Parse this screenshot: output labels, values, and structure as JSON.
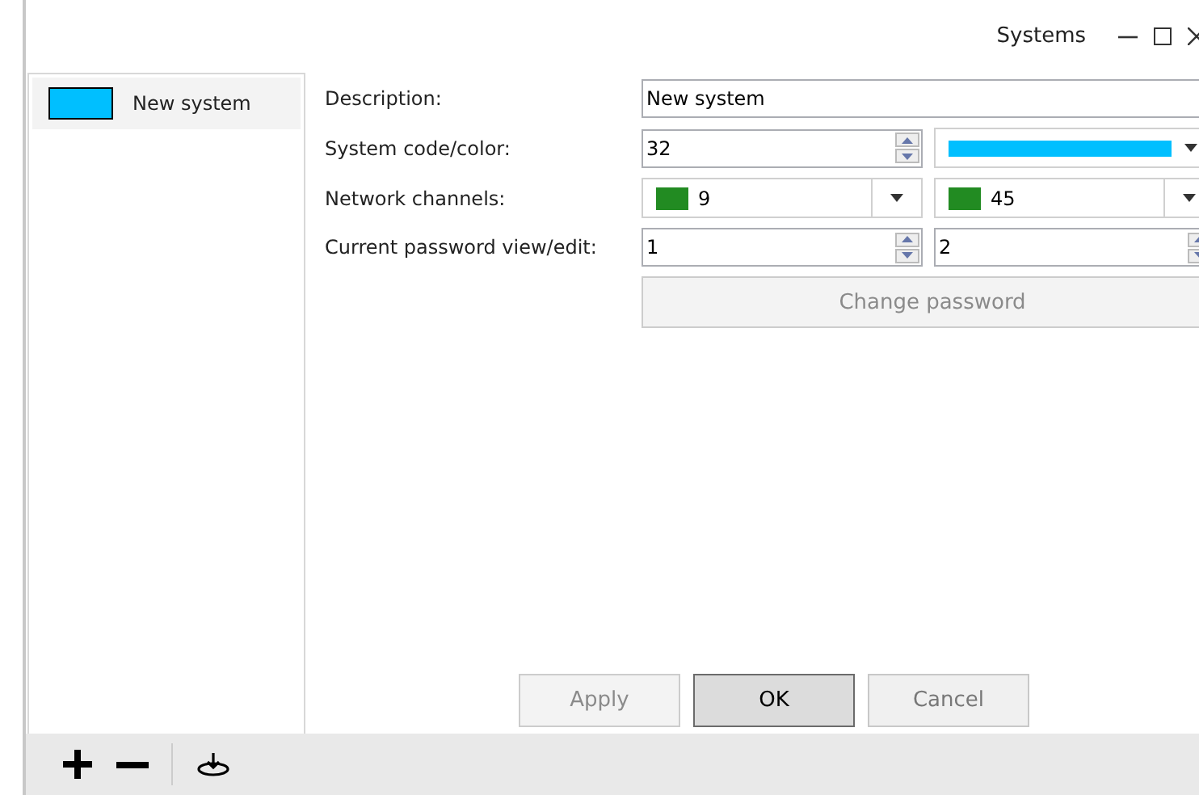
{
  "window": {
    "title": "Systems"
  },
  "systems": [
    {
      "label": "New system",
      "color": "#00bfff",
      "selected": true
    }
  ],
  "form": {
    "description": {
      "label": "Description:",
      "value": "New system"
    },
    "code": {
      "label": "System code/color:",
      "value": "32",
      "color": "#00bfff"
    },
    "channels": {
      "label": "Network channels:",
      "items": [
        {
          "value": "9",
          "color": "#228b22"
        },
        {
          "value": "45",
          "color": "#228b22"
        }
      ]
    },
    "password": {
      "label": "Current password view/edit:",
      "view": "1",
      "edit": "2"
    },
    "change_password": {
      "label": "Change password",
      "disabled": true
    }
  },
  "buttons": [
    {
      "label": "Apply",
      "disabled": true,
      "default": false
    },
    {
      "label": "OK",
      "disabled": false,
      "default": true
    },
    {
      "label": "Cancel",
      "disabled": false,
      "default": false
    }
  ],
  "toolbar": [
    {
      "kind": "add"
    },
    {
      "kind": "remove"
    },
    {
      "kind": "separator"
    },
    {
      "kind": "import"
    }
  ]
}
